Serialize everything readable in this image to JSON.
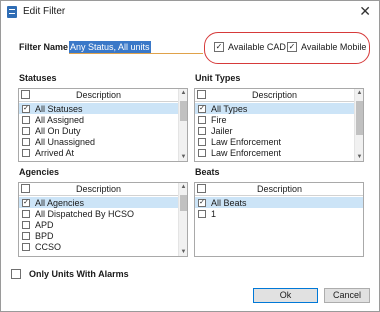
{
  "window": {
    "title": "Edit Filter",
    "close_glyph": "✕",
    "icon": "filter-app-icon"
  },
  "filter_name": {
    "label": "Filter Name",
    "value": "Any Status, All units"
  },
  "options": {
    "available_cad": {
      "label": "Available CAD",
      "checked": true
    },
    "available_mobile": {
      "label": "Available Mobile",
      "checked": true
    }
  },
  "statuses": {
    "title": "Statuses",
    "column": "Description",
    "items": [
      {
        "label": "All Statuses",
        "checked": true,
        "selected": true
      },
      {
        "label": "All Assigned",
        "checked": false
      },
      {
        "label": "All On Duty",
        "checked": false
      },
      {
        "label": "All Unassigned",
        "checked": false
      },
      {
        "label": "Arrived At",
        "checked": false
      }
    ]
  },
  "unit_types": {
    "title": "Unit Types",
    "column": "Description",
    "items": [
      {
        "label": "All Types",
        "checked": true,
        "selected": true
      },
      {
        "label": "Fire",
        "checked": false
      },
      {
        "label": "Jailer",
        "checked": false
      },
      {
        "label": "Law Enforcement",
        "checked": false
      },
      {
        "label": "Law Enforcement",
        "checked": false
      }
    ]
  },
  "agencies": {
    "title": "Agencies",
    "column": "Description",
    "items": [
      {
        "label": "All Agencies",
        "checked": true,
        "selected": true
      },
      {
        "label": "All Dispatched By HCSO",
        "checked": false
      },
      {
        "label": "APD",
        "checked": false
      },
      {
        "label": "BPD",
        "checked": false
      },
      {
        "label": "CCSO",
        "checked": false
      }
    ]
  },
  "beats": {
    "title": "Beats",
    "column": "Description",
    "items": [
      {
        "label": "All Beats",
        "checked": true,
        "selected": true
      },
      {
        "label": "1",
        "checked": false
      }
    ]
  },
  "alarms_option": {
    "label": "Only Units With Alarms",
    "checked": false
  },
  "buttons": {
    "ok": "Ok",
    "cancel": "Cancel"
  },
  "colors": {
    "selection": "#cce4f7",
    "highlight_ring": "#d63a3a",
    "name_selection": "#3a78c8"
  }
}
